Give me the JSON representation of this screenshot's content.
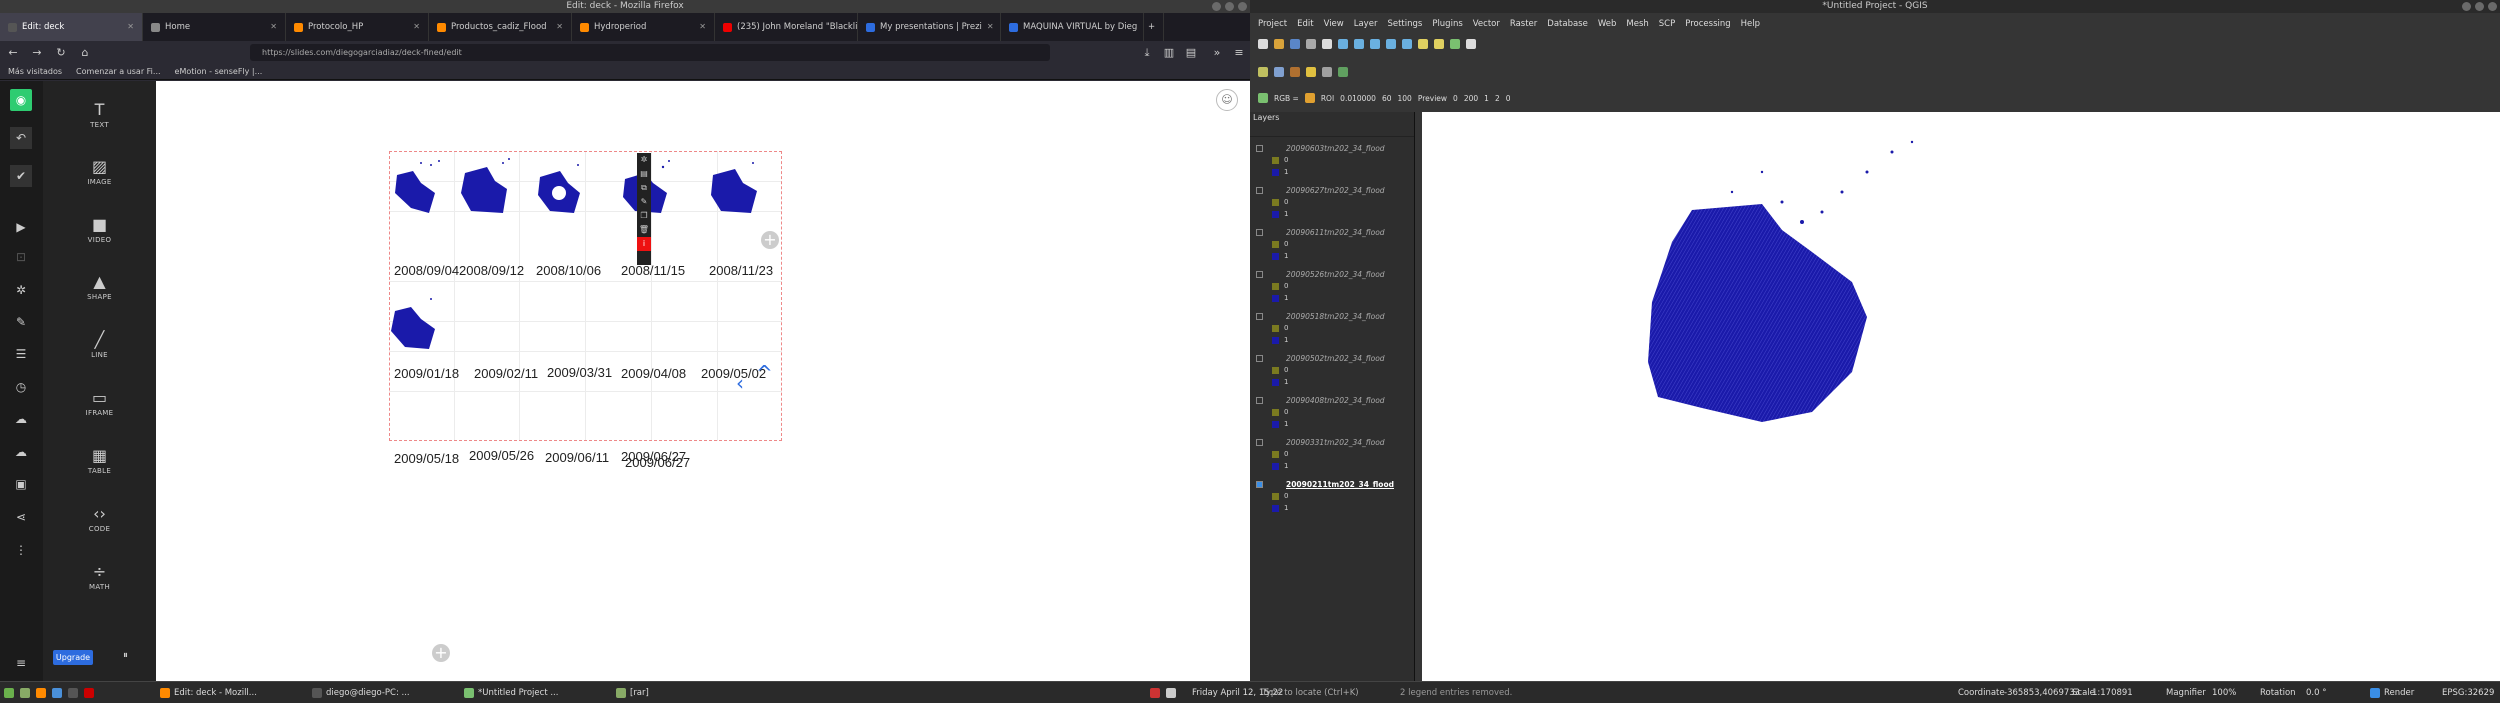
{
  "firefox": {
    "window_title": "Edit: deck - Mozilla Firefox",
    "tabs": [
      {
        "label": "Edit: deck",
        "color": "#3a3a3a",
        "active": true
      },
      {
        "label": "Home",
        "color": "#888"
      },
      {
        "label": "Protocolo_HP",
        "color": "#ff8a00"
      },
      {
        "label": "Productos_cadiz_Flood",
        "color": "#ff8a00"
      },
      {
        "label": "Hydroperiod",
        "color": "#ff8a00"
      },
      {
        "label": "(235) John Moreland \"Blacklis",
        "color": "#e00"
      },
      {
        "label": "My presentations | Prezi",
        "color": "#2d6cdf"
      },
      {
        "label": "MAQUINA VIRTUAL by Dieg",
        "color": "#2d6cdf"
      }
    ],
    "url": "https://slides.com/diegogarciadiaz/deck-fined/edit",
    "bookmarks": [
      "Más visitados",
      "Comenzar a usar Fi...",
      "eMotion - senseFly |..."
    ],
    "tools": [
      "TEXT",
      "IMAGE",
      "VIDEO",
      "SHAPE",
      "LINE",
      "IFRAME",
      "TABLE",
      "CODE",
      "MATH"
    ],
    "upgrade_label": "Upgrade",
    "dates_row1": [
      "2008/09/04",
      "2008/09/12",
      "2008/10/06",
      "2008/11/15",
      "2008/11/23"
    ],
    "dates_row2": [
      "2009/01/18",
      "2009/02/11",
      "2009/03/31",
      "2009/04/08",
      "2009/05/02"
    ],
    "dates_row3": [
      "2009/05/18",
      "2009/05/26",
      "2009/06/11",
      "2009/06/27"
    ],
    "date_overlap": "2009/06/27"
  },
  "qgis": {
    "window_title": "*Untitled Project - QGIS",
    "menu": [
      "Project",
      "Edit",
      "View",
      "Layer",
      "Settings",
      "Plugins",
      "Vector",
      "Raster",
      "Database",
      "Web",
      "Mesh",
      "SCP",
      "Processing",
      "Help"
    ],
    "toolbar_fields": {
      "rgb": "RGB =",
      "roi": "ROI",
      "dist": "0.010000",
      "min": "60",
      "max": "100",
      "preview": "Preview",
      "v1": "0",
      "v2": "200",
      "band": "1",
      "b2": "2",
      "b3": "0"
    },
    "layers_title": "Layers",
    "layers": [
      "20090603tm202_34_flood",
      "20090627tm202_34_flood",
      "20090611tm202_34_flood",
      "20090526tm202_34_flood",
      "20090518tm202_34_flood",
      "20090502tm202_34_flood",
      "20090408tm202_34_flood",
      "20090331tm202_34_flood",
      "20090211tm202_34_flood"
    ],
    "legend_values": [
      "0",
      "1"
    ],
    "status": {
      "locate_placeholder": "Type to locate (Ctrl+K)",
      "msg": "2 legend entries removed.",
      "coordinate_label": "Coordinate",
      "coordinate": "-365853,4069733",
      "scale_label": "Scale",
      "scale": "1:170891",
      "magnifier_label": "Magnifier",
      "magnifier": "100%",
      "rotation_label": "Rotation",
      "rotation": "0.0 °",
      "render": "Render",
      "crs": "EPSG:32629"
    }
  },
  "taskbar": {
    "apps": [
      "Edit: deck - Mozill...",
      "diego@diego-PC: ...",
      "*Untitled Project ...",
      "[rar]"
    ],
    "clock": "Friday April 12, 15:22"
  },
  "colors": {
    "flood": "#1a1aaa",
    "accent_green": "#2ecc71",
    "red": "#e01010"
  }
}
